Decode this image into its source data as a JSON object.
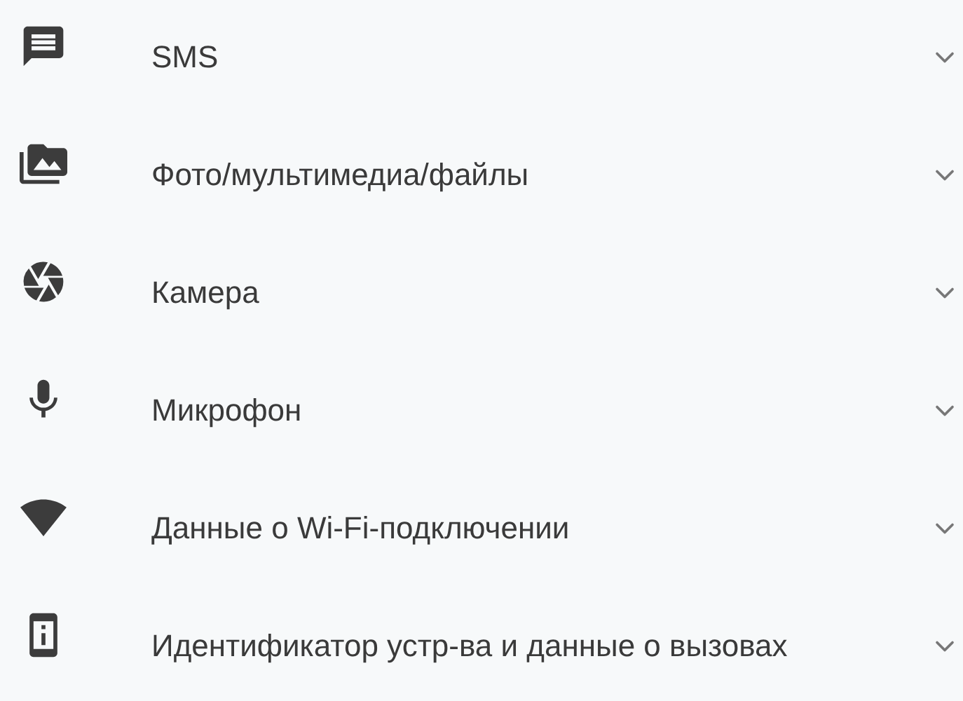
{
  "permissions": [
    {
      "kind": "sms",
      "label": "SMS",
      "expanded": false
    },
    {
      "kind": "media",
      "label": "Фото/мультимедиа/файлы",
      "expanded": false
    },
    {
      "kind": "camera",
      "label": "Камера",
      "expanded": false
    },
    {
      "kind": "microphone",
      "label": "Микрофон",
      "expanded": false
    },
    {
      "kind": "wifi",
      "label": "Данные о Wi-Fi-подключении",
      "expanded": false
    },
    {
      "kind": "device",
      "label": "Идентификатор устр-ва и данные о вызовах",
      "expanded": false
    }
  ]
}
